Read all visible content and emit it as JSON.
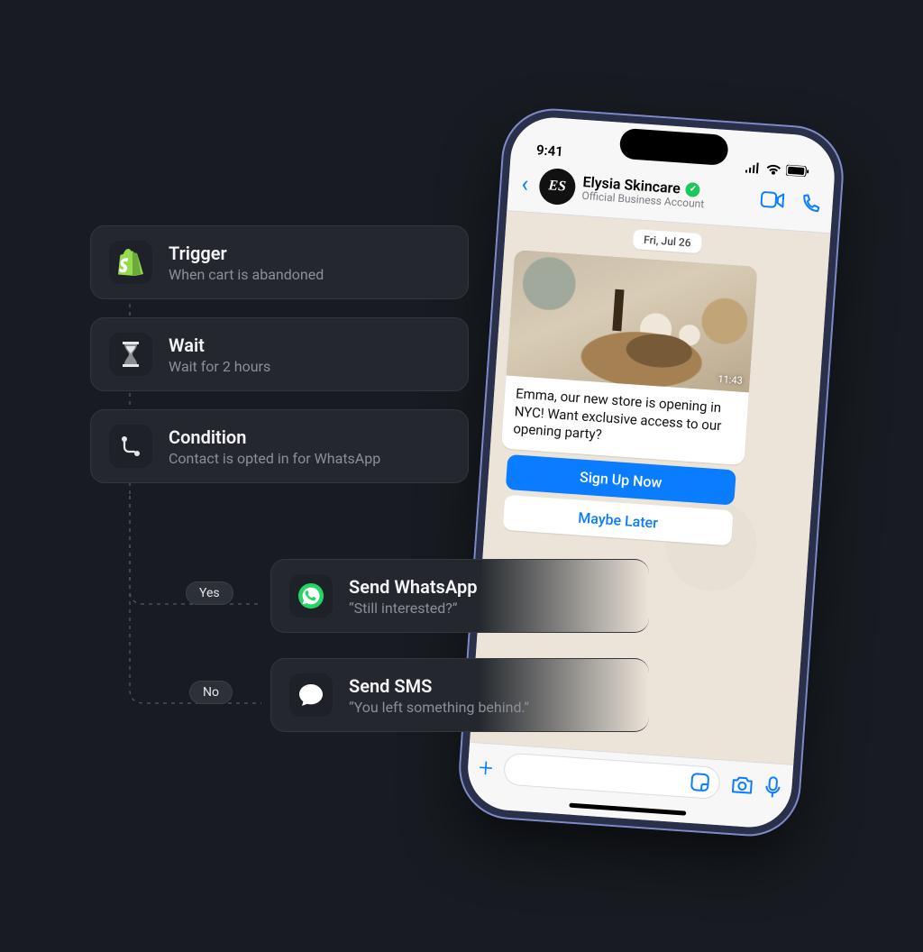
{
  "flow": {
    "trigger": {
      "title": "Trigger",
      "subtitle": "When cart is abandoned"
    },
    "wait": {
      "title": "Wait",
      "subtitle": "Wait for 2 hours"
    },
    "condition": {
      "title": "Condition",
      "subtitle": "Contact is opted in for WhatsApp"
    },
    "yes_label": "Yes",
    "no_label": "No",
    "branch_yes": {
      "title": "Send WhatsApp",
      "subtitle": "“Still interested?”"
    },
    "branch_no": {
      "title": "Send SMS",
      "subtitle": "“You left something behind.”"
    }
  },
  "phone": {
    "status_time": "9:41",
    "contact_name": "Elysia Skincare",
    "contact_type": "Official Business Account",
    "avatar_initials": "ES",
    "date_chip": "Fri, Jul 26",
    "message_text": "Emma, our new store is opening in NYC! Want exclusive access to our opening party?",
    "message_time": "11:43",
    "cta_primary": "Sign Up Now",
    "cta_secondary": "Maybe Later"
  },
  "colors": {
    "accent_blue": "#0a7cff",
    "whatsapp_green": "#25d366",
    "shopify_green": "#96db4f"
  }
}
